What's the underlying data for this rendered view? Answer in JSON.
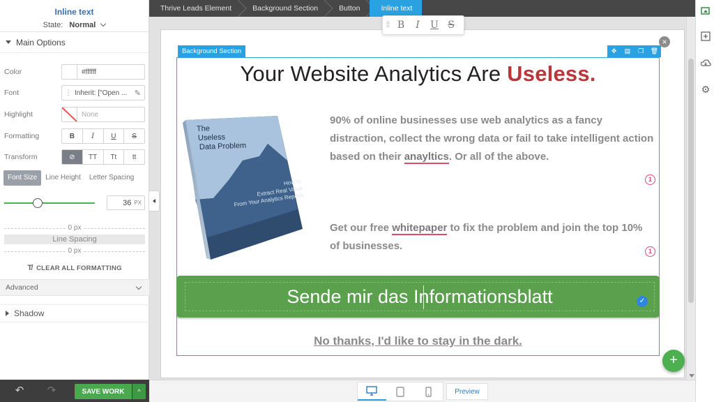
{
  "panel": {
    "title": "Inline text",
    "state_label": "State:",
    "state_value": "Normal",
    "main_options_label": "Main Options",
    "color_label": "Color",
    "color_value": "#ffffff",
    "font_label": "Font",
    "font_value": "Inherit: [\"Open ...",
    "highlight_label": "Highlight",
    "highlight_value": "None",
    "formatting_label": "Formatting",
    "formatting_buttons": [
      "B",
      "I",
      "U",
      "S"
    ],
    "transform_label": "Transform",
    "transform_buttons": [
      "⊘",
      "TT",
      "Tt",
      "tt"
    ],
    "size_tabs": [
      "Font Size",
      "Line Height",
      "Letter Spacing"
    ],
    "font_size_value": "36",
    "font_size_unit": "PX",
    "font_size_slider_fraction": 0.37,
    "spacing_top": "0 px",
    "line_spacing_label": "Line Spacing",
    "spacing_bottom": "0 px",
    "clear_formatting_label": "CLEAR ALL FORMATTING",
    "advanced_label": "Advanced",
    "shadow_label": "Shadow"
  },
  "bottom_bar": {
    "save_label": "SAVE WORK",
    "save_caret": "^"
  },
  "breadcrumb": [
    "Thrive Leads Element",
    "Background Section",
    "Button",
    "Inline text"
  ],
  "format_toolbar": [
    "B",
    "I",
    "U",
    "S"
  ],
  "canvas": {
    "section_badge": "Background Section",
    "headline_prefix": "Your Website Analytics Are ",
    "headline_accent": "Useless.",
    "book": {
      "title_line1": "The",
      "title_line2": "Useless",
      "title_line3": "Data Problem",
      "subtitle_line1": "How to",
      "subtitle_line2": "Extract Real Value",
      "subtitle_line3": "From Your Analytics Reports"
    },
    "para1_start": "90% of online businesses use web analytics as a fancy distraction, collect the wrong data or fail to take intelligent action based on their ",
    "para1_misspelled": "anayltics",
    "para1_end": ". Or all of the above.",
    "para2_start": "Get our free ",
    "para2_misspelled": "whitepaper",
    "para2_end": " to fix the problem and join the top 10% of businesses.",
    "spell_badge_1": "1",
    "spell_badge_2": "1",
    "cta_text": "Sende mir das Informationsblatt",
    "no_thanks": "No thanks, I'd like to stay in the dark."
  },
  "device_bar": {
    "preview_label": "Preview"
  },
  "colors": {
    "accent_blue": "#2aa1e0",
    "cta_green": "#5aa04d",
    "headline_red": "#b9363a",
    "save_green": "#4aa84f"
  },
  "icons": {
    "right_bar": [
      "paint-icon",
      "add-element-icon",
      "cloud-icon",
      "settings-gear-icon"
    ],
    "devices": [
      "desktop-icon",
      "tablet-icon",
      "mobile-icon"
    ]
  }
}
